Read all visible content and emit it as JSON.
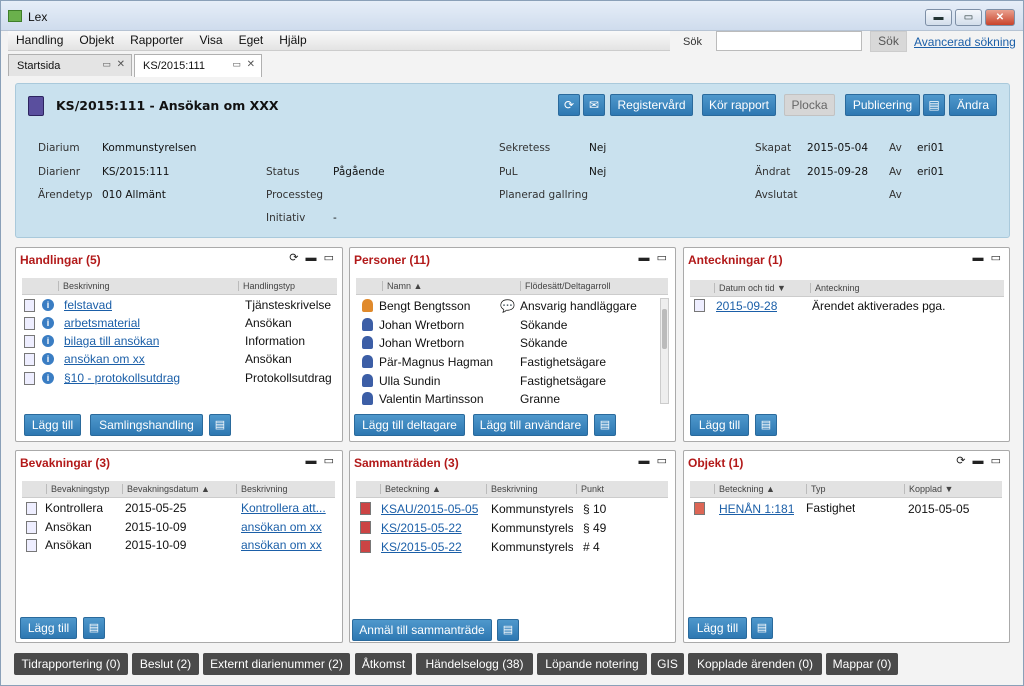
{
  "app": {
    "title": "Lex"
  },
  "window_controls": {
    "minimize": "▬",
    "maximize": "▭",
    "close": "✕"
  },
  "menu": [
    "Handling",
    "Objekt",
    "Rapporter",
    "Visa",
    "Eget",
    "Hjälp"
  ],
  "search": {
    "label": "Sök",
    "value": "",
    "button": "Sök",
    "advanced": "Avancerad sökning"
  },
  "tabs": [
    {
      "label": "Startsida"
    },
    {
      "label": "KS/2015:111"
    }
  ],
  "case": {
    "title": "KS/2015:111 - Ansökan om XXX",
    "toolbar": {
      "registervard": "Registervård",
      "kor_rapport": "Kör rapport",
      "plocka": "Plocka",
      "publicering": "Publicering",
      "andra": "Ändra"
    },
    "fields": {
      "diarium_l": "Diarium",
      "diarium_v": "Kommunstyrelsen",
      "diarienr_l": "Diarienr",
      "diarienr_v": "KS/2015:111",
      "arendetyp_l": "Ärendetyp",
      "arendetyp_v": "010 Allmänt",
      "status_l": "Status",
      "status_v": "Pågående",
      "processteg_l": "Processteg",
      "initiativ_l": "Initiativ",
      "initiativ_v": "-",
      "sekretess_l": "Sekretess",
      "sekretess_v": "Nej",
      "pul_l": "PuL",
      "pul_v": "Nej",
      "gallring_l": "Planerad gallring",
      "skapat_l": "Skapat",
      "skapat_v": "2015-05-04",
      "andrat_l": "Ändrat",
      "andrat_v": "2015-09-28",
      "avslutat_l": "Avslutat",
      "av_l": "Av",
      "av1_v": "eri01",
      "av2_v": "eri01"
    }
  },
  "handlingar": {
    "title": "Handlingar (5)",
    "cols": [
      "Beskrivning",
      "Handlingstyp"
    ],
    "rows": [
      [
        "felstavad",
        "Tjänsteskrivelse"
      ],
      [
        "arbetsmaterial",
        "Ansökan"
      ],
      [
        "bilaga till ansökan",
        "Information"
      ],
      [
        "ansökan om xx",
        "Ansökan"
      ],
      [
        "§10 - protokollsutdrag",
        "Protokollsutdrag"
      ]
    ],
    "btn_add": "Lägg till",
    "btn_saml": "Samlingshandling"
  },
  "personer": {
    "title": "Personer (11)",
    "cols": [
      "Namn",
      "Flödesätt/Deltagarroll"
    ],
    "rows": [
      [
        "Bengt Bengtsson",
        "Ansvarig handläggare"
      ],
      [
        "Johan Wretborn",
        "Sökande"
      ],
      [
        "Johan Wretborn",
        "Sökande"
      ],
      [
        "Pär-Magnus Hagman",
        "Fastighetsägare"
      ],
      [
        "Ulla Sundin",
        "Fastighetsägare"
      ],
      [
        "Valentin Martinsson",
        "Granne"
      ]
    ],
    "btn_delt": "Lägg till deltagare",
    "btn_anv": "Lägg till användare"
  },
  "anteckningar": {
    "title": "Anteckningar (1)",
    "cols": [
      "Datum och tid",
      "Anteckning"
    ],
    "rows": [
      [
        "2015-09-28",
        "Ärendet aktiverades pga."
      ]
    ],
    "btn_add": "Lägg till"
  },
  "bevakningar": {
    "title": "Bevakningar (3)",
    "cols": [
      "Bevakningstyp",
      "Bevakningsdatum",
      "Beskrivning"
    ],
    "rows": [
      [
        "Kontrollera",
        "2015-05-25",
        "Kontrollera att..."
      ],
      [
        "Ansökan",
        "2015-10-09",
        "ansökan om xx"
      ],
      [
        "Ansökan",
        "2015-10-09",
        "ansökan om xx"
      ]
    ],
    "btn_add": "Lägg till"
  },
  "sammantraden": {
    "title": "Sammanträden (3)",
    "cols": [
      "Beteckning",
      "Beskrivning",
      "Punkt"
    ],
    "rows": [
      [
        "KSAU/2015-05-05",
        "Kommunstyrelse",
        "§ 10"
      ],
      [
        "KS/2015-05-22",
        "Kommunstyrelse",
        "§ 49"
      ],
      [
        "KS/2015-05-22",
        "Kommunstyrelse",
        "# 4"
      ]
    ],
    "btn_anmal": "Anmäl till sammanträde"
  },
  "objekt": {
    "title": "Objekt (1)",
    "cols": [
      "Beteckning",
      "Typ",
      "Kopplad"
    ],
    "rows": [
      [
        "HENÅN 1:181",
        "Fastighet",
        "2015-05-05"
      ]
    ],
    "btn_add": "Lägg till"
  },
  "bottom_tabs": [
    "Tidrapportering (0)",
    "Beslut (2)",
    "Externt diarienummer (2)",
    "Åtkomst",
    "Händelselogg (38)",
    "Löpande notering",
    "GIS",
    "Kopplade ärenden (0)",
    "Mappar (0)"
  ]
}
